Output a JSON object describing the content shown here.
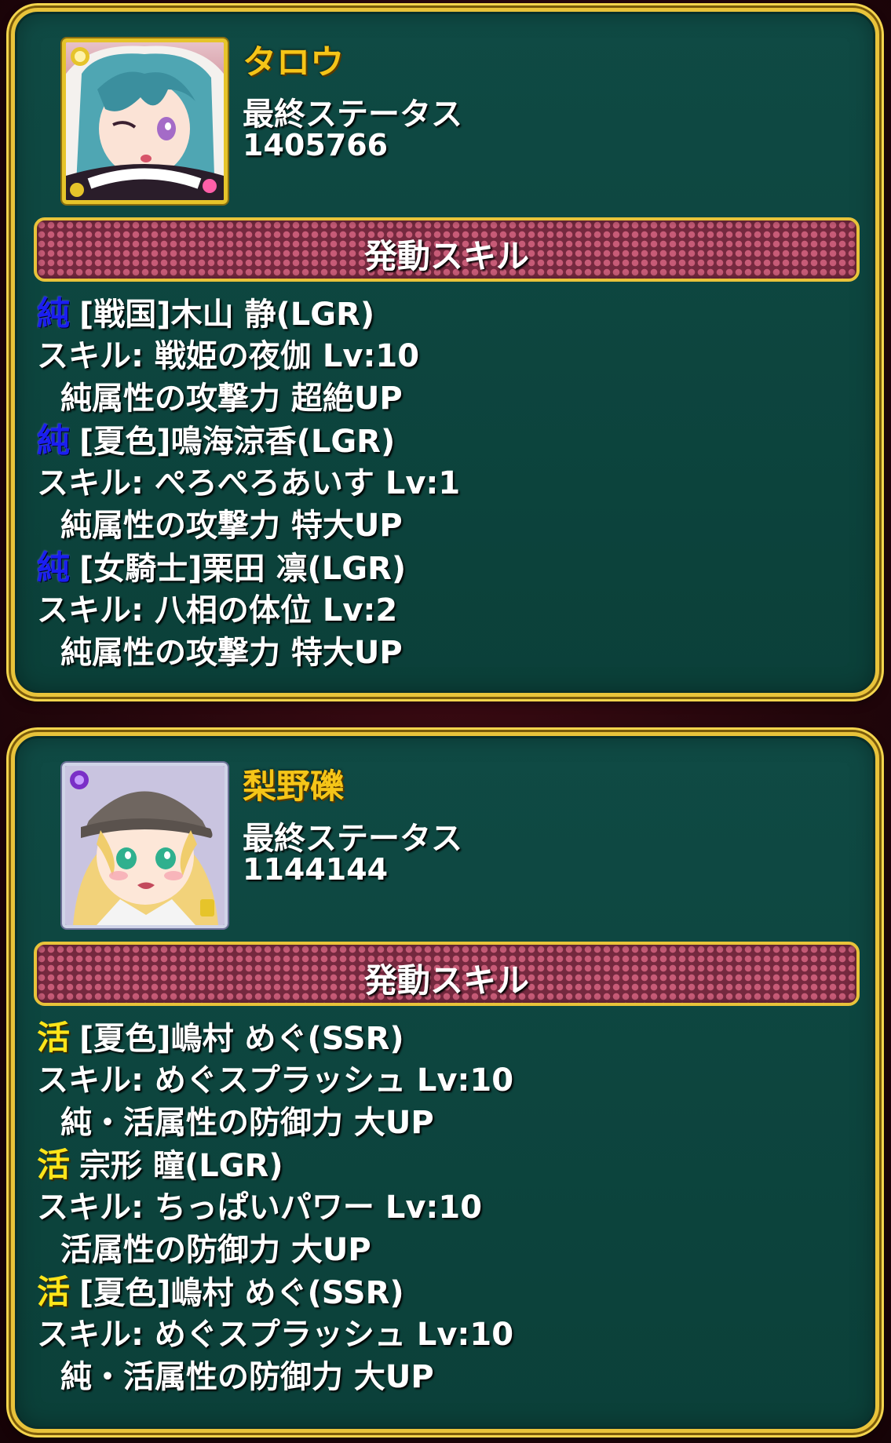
{
  "colors": {
    "background": "#22060b",
    "panel": "#0c433c",
    "panel_border": "#e9c33a",
    "name_gold": "#f5c518",
    "banner": "#75293f",
    "attr_pure": "#1a1ef0",
    "attr_live": "#ffe51a"
  },
  "cards": [
    {
      "name": "タロウ",
      "status_label": "最終ステータス",
      "status_value": "1405766",
      "portrait": {
        "frame": "gold",
        "icon": "portrait-silver-haired-girl-winking"
      },
      "skill_header": "発動スキル",
      "skills": [
        {
          "attribute": "純",
          "member": "[戦国]木山 静(LGR)",
          "skill_line": "スキル: 戦姫の夜伽  Lv:10",
          "effect": "純属性の攻撃力 超絶UP"
        },
        {
          "attribute": "純",
          "member": "[夏色]鳴海涼香(LGR)",
          "skill_line": "スキル: ぺろぺろあいす  Lv:1",
          "effect": "純属性の攻撃力 特大UP"
        },
        {
          "attribute": "純",
          "member": "[女騎士]栗田 凛(LGR)",
          "skill_line": "スキル: 八相の体位  Lv:2",
          "effect": "純属性の攻撃力 特大UP"
        }
      ]
    },
    {
      "name": "梨野礫",
      "status_label": "最終ステータス",
      "status_value": "1144144",
      "portrait": {
        "frame": "silver",
        "icon": "portrait-blonde-girl-with-cap"
      },
      "skill_header": "発動スキル",
      "skills": [
        {
          "attribute": "活",
          "member": "[夏色]嶋村 めぐ(SSR)",
          "skill_line": "スキル: めぐスプラッシュ  Lv:10",
          "effect": "純・活属性の防御力 大UP"
        },
        {
          "attribute": "活",
          "member": "宗形 瞳(LGR)",
          "skill_line": "スキル: ちっぱいパワー  Lv:10",
          "effect": "活属性の防御力 大UP"
        },
        {
          "attribute": "活",
          "member": "[夏色]嶋村 めぐ(SSR)",
          "skill_line": "スキル: めぐスプラッシュ  Lv:10",
          "effect": "純・活属性の防御力 大UP"
        }
      ]
    }
  ]
}
